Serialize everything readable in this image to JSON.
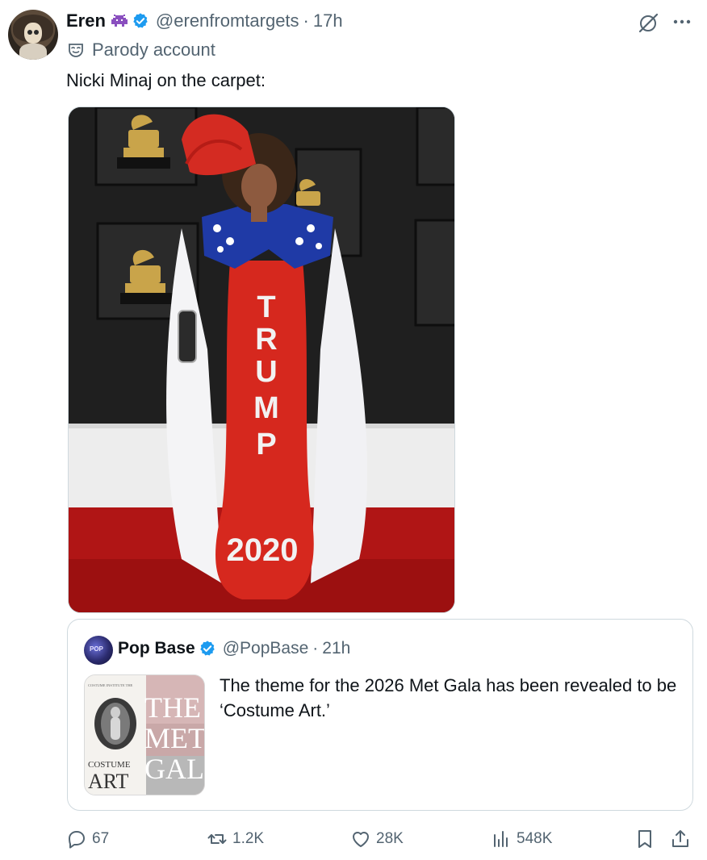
{
  "tweet": {
    "author_name": "Eren",
    "author_emoji": "space-invader-emoji",
    "handle": "@erenfromtargets",
    "separator": "·",
    "time": "17h",
    "parody_label": "Parody account",
    "text": "Nicki Minaj on the carpet:",
    "image_text": "TRUMP 2020"
  },
  "quote": {
    "author_name": "Pop Base",
    "handle": "@PopBase",
    "separator": "·",
    "time": "21h",
    "text": "The theme for the 2026 Met Gala has been revealed to be ‘Costume Art.’",
    "thumb_small_text": "COSTUME INSTITUTE THE",
    "thumb_costume": "COSTUME",
    "thumb_art": "ART",
    "thumb_the": "THE",
    "thumb_met": "MET",
    "thumb_gal": "GAL"
  },
  "actions": {
    "replies": "67",
    "reposts": "1.2K",
    "likes": "28K",
    "views": "548K"
  },
  "colors": {
    "text": "#0f1419",
    "secondary": "#536471",
    "verified": "#1d9bf0",
    "border": "#cfd9de"
  },
  "icons": [
    "parody-mask-icon",
    "grok-icon",
    "more-icon",
    "verified-badge-icon",
    "reply-icon",
    "repost-icon",
    "like-icon",
    "views-icon",
    "bookmark-icon",
    "share-icon"
  ]
}
